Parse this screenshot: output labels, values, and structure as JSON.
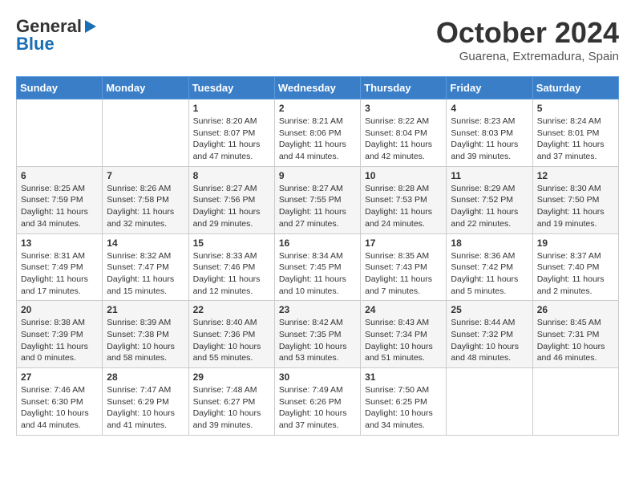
{
  "logo": {
    "line1": "General",
    "line2": "Blue"
  },
  "header": {
    "month": "October 2024",
    "location": "Guarena, Extremadura, Spain"
  },
  "weekdays": [
    "Sunday",
    "Monday",
    "Tuesday",
    "Wednesday",
    "Thursday",
    "Friday",
    "Saturday"
  ],
  "weeks": [
    [
      {
        "day": "",
        "info": ""
      },
      {
        "day": "",
        "info": ""
      },
      {
        "day": "1",
        "info": "Sunrise: 8:20 AM\nSunset: 8:07 PM\nDaylight: 11 hours and 47 minutes."
      },
      {
        "day": "2",
        "info": "Sunrise: 8:21 AM\nSunset: 8:06 PM\nDaylight: 11 hours and 44 minutes."
      },
      {
        "day": "3",
        "info": "Sunrise: 8:22 AM\nSunset: 8:04 PM\nDaylight: 11 hours and 42 minutes."
      },
      {
        "day": "4",
        "info": "Sunrise: 8:23 AM\nSunset: 8:03 PM\nDaylight: 11 hours and 39 minutes."
      },
      {
        "day": "5",
        "info": "Sunrise: 8:24 AM\nSunset: 8:01 PM\nDaylight: 11 hours and 37 minutes."
      }
    ],
    [
      {
        "day": "6",
        "info": "Sunrise: 8:25 AM\nSunset: 7:59 PM\nDaylight: 11 hours and 34 minutes."
      },
      {
        "day": "7",
        "info": "Sunrise: 8:26 AM\nSunset: 7:58 PM\nDaylight: 11 hours and 32 minutes."
      },
      {
        "day": "8",
        "info": "Sunrise: 8:27 AM\nSunset: 7:56 PM\nDaylight: 11 hours and 29 minutes."
      },
      {
        "day": "9",
        "info": "Sunrise: 8:27 AM\nSunset: 7:55 PM\nDaylight: 11 hours and 27 minutes."
      },
      {
        "day": "10",
        "info": "Sunrise: 8:28 AM\nSunset: 7:53 PM\nDaylight: 11 hours and 24 minutes."
      },
      {
        "day": "11",
        "info": "Sunrise: 8:29 AM\nSunset: 7:52 PM\nDaylight: 11 hours and 22 minutes."
      },
      {
        "day": "12",
        "info": "Sunrise: 8:30 AM\nSunset: 7:50 PM\nDaylight: 11 hours and 19 minutes."
      }
    ],
    [
      {
        "day": "13",
        "info": "Sunrise: 8:31 AM\nSunset: 7:49 PM\nDaylight: 11 hours and 17 minutes."
      },
      {
        "day": "14",
        "info": "Sunrise: 8:32 AM\nSunset: 7:47 PM\nDaylight: 11 hours and 15 minutes."
      },
      {
        "day": "15",
        "info": "Sunrise: 8:33 AM\nSunset: 7:46 PM\nDaylight: 11 hours and 12 minutes."
      },
      {
        "day": "16",
        "info": "Sunrise: 8:34 AM\nSunset: 7:45 PM\nDaylight: 11 hours and 10 minutes."
      },
      {
        "day": "17",
        "info": "Sunrise: 8:35 AM\nSunset: 7:43 PM\nDaylight: 11 hours and 7 minutes."
      },
      {
        "day": "18",
        "info": "Sunrise: 8:36 AM\nSunset: 7:42 PM\nDaylight: 11 hours and 5 minutes."
      },
      {
        "day": "19",
        "info": "Sunrise: 8:37 AM\nSunset: 7:40 PM\nDaylight: 11 hours and 2 minutes."
      }
    ],
    [
      {
        "day": "20",
        "info": "Sunrise: 8:38 AM\nSunset: 7:39 PM\nDaylight: 11 hours and 0 minutes."
      },
      {
        "day": "21",
        "info": "Sunrise: 8:39 AM\nSunset: 7:38 PM\nDaylight: 10 hours and 58 minutes."
      },
      {
        "day": "22",
        "info": "Sunrise: 8:40 AM\nSunset: 7:36 PM\nDaylight: 10 hours and 55 minutes."
      },
      {
        "day": "23",
        "info": "Sunrise: 8:42 AM\nSunset: 7:35 PM\nDaylight: 10 hours and 53 minutes."
      },
      {
        "day": "24",
        "info": "Sunrise: 8:43 AM\nSunset: 7:34 PM\nDaylight: 10 hours and 51 minutes."
      },
      {
        "day": "25",
        "info": "Sunrise: 8:44 AM\nSunset: 7:32 PM\nDaylight: 10 hours and 48 minutes."
      },
      {
        "day": "26",
        "info": "Sunrise: 8:45 AM\nSunset: 7:31 PM\nDaylight: 10 hours and 46 minutes."
      }
    ],
    [
      {
        "day": "27",
        "info": "Sunrise: 7:46 AM\nSunset: 6:30 PM\nDaylight: 10 hours and 44 minutes."
      },
      {
        "day": "28",
        "info": "Sunrise: 7:47 AM\nSunset: 6:29 PM\nDaylight: 10 hours and 41 minutes."
      },
      {
        "day": "29",
        "info": "Sunrise: 7:48 AM\nSunset: 6:27 PM\nDaylight: 10 hours and 39 minutes."
      },
      {
        "day": "30",
        "info": "Sunrise: 7:49 AM\nSunset: 6:26 PM\nDaylight: 10 hours and 37 minutes."
      },
      {
        "day": "31",
        "info": "Sunrise: 7:50 AM\nSunset: 6:25 PM\nDaylight: 10 hours and 34 minutes."
      },
      {
        "day": "",
        "info": ""
      },
      {
        "day": "",
        "info": ""
      }
    ]
  ]
}
